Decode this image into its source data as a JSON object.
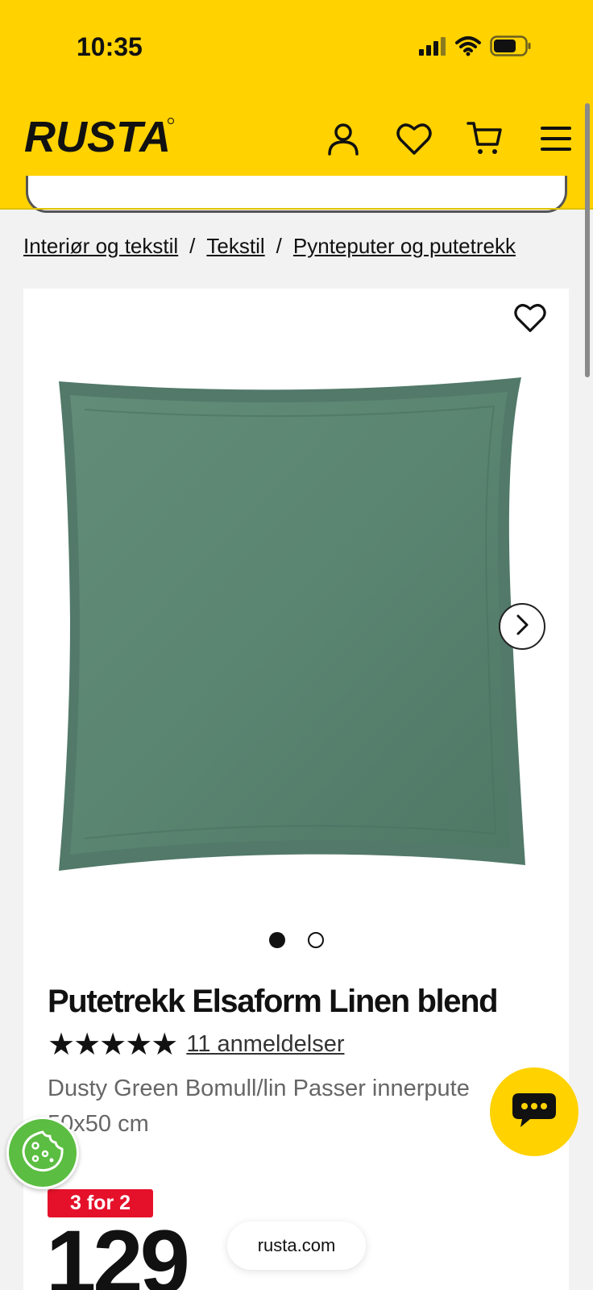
{
  "status_bar": {
    "time": "10:35"
  },
  "header": {
    "logo_text": "RUSTA",
    "icons": [
      "user-icon",
      "heart-icon",
      "cart-icon",
      "menu-icon"
    ],
    "brand_color": "#ffd200"
  },
  "breadcrumb": {
    "items": [
      "Interiør og tekstil",
      "Tekstil",
      "Pynteputer og putetrekk"
    ],
    "separator": "/"
  },
  "product": {
    "title": "Putetrekk Elsaform Linen blend",
    "stars": "★★★★★",
    "rating_value": 5,
    "reviews_label": "11 anmeldelser",
    "description": "Dusty Green Bomull/lin Passer innerpute 50x50 cm",
    "badge": "3 for 2",
    "price": "129",
    "image_count": 2,
    "active_image": 1,
    "image_color": "#5e8874"
  },
  "browser": {
    "url": "rusta.com"
  },
  "colors": {
    "badge": "#e5112b",
    "cookie": "#5bbd41",
    "accent": "#ffd200"
  }
}
